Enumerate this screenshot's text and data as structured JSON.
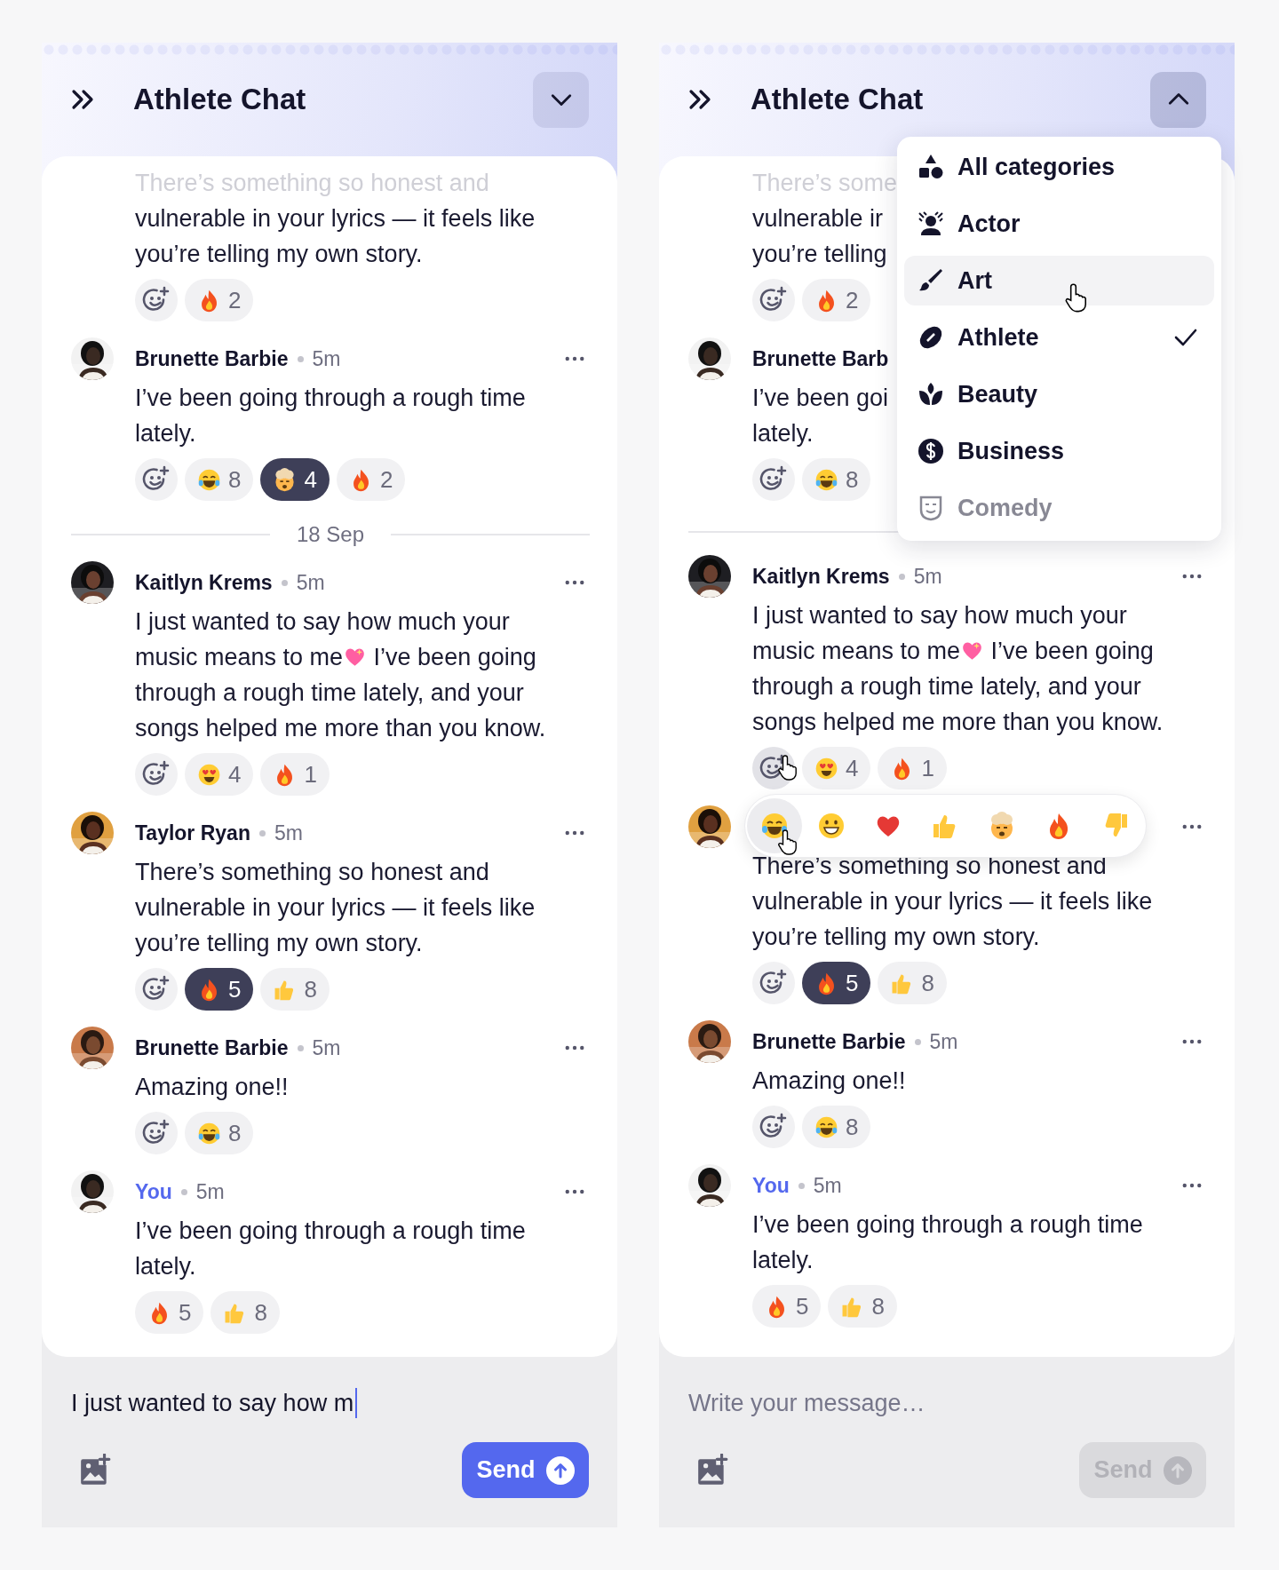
{
  "panels": [
    {
      "header": {
        "title": "Athlete Chat",
        "expanded": false
      },
      "messages": [
        {
          "kind": "message",
          "faded": true,
          "lines": [
            {
              "text": "There’s something so honest and"
            },
            {
              "text": "vulnerable in your lyrics — it feels like"
            },
            {
              "text": "you’re telling my own story."
            }
          ],
          "add_reaction": {
            "hovered": false
          },
          "reactions": [
            {
              "kind": "fire",
              "count": "2",
              "selected": false
            }
          ]
        },
        {
          "kind": "message",
          "avatar": {
            "kind": "picture"
          },
          "name": "Brunette Barbie",
          "time": "5m",
          "own": false,
          "lines": [
            {
              "text": "I’ve been going through a rough time"
            },
            {
              "text": "lately."
            }
          ],
          "add_reaction": {
            "hovered": false
          },
          "reactions": [
            {
              "kind": "laugh",
              "count": "8",
              "selected": false
            },
            {
              "kind": "exploding-head",
              "count": "4",
              "selected": true
            },
            {
              "kind": "fire",
              "count": "2",
              "selected": false
            }
          ]
        },
        {
          "kind": "separator",
          "label": "18 Sep"
        },
        {
          "kind": "message",
          "avatar": {
            "kind": "picture"
          },
          "name": "Kaitlyn Krems",
          "time": "5m",
          "own": false,
          "lines": [
            {
              "text": "I just wanted to say how much your"
            },
            {
              "text": "music means to me",
              "kind": "sparkling-heart",
              "after": "I’ve been going"
            },
            {
              "text": "through a rough time lately, and your"
            },
            {
              "text": "songs helped me more than you know."
            }
          ],
          "add_reaction": {
            "hovered": false
          },
          "reactions": [
            {
              "kind": "heart-eyes",
              "count": "4",
              "selected": false
            },
            {
              "kind": "fire",
              "count": "1",
              "selected": false
            }
          ]
        },
        {
          "kind": "message",
          "avatar": {
            "kind": "picture"
          },
          "name": "Taylor Ryan",
          "time": "5m",
          "own": false,
          "lines": [
            {
              "text": "There’s something so honest and"
            },
            {
              "text": "vulnerable in your lyrics — it feels like"
            },
            {
              "text": "you’re telling my own story."
            }
          ],
          "add_reaction": {
            "hovered": false
          },
          "reactions": [
            {
              "kind": "fire",
              "count": "5",
              "selected": true
            },
            {
              "kind": "thumbs-up",
              "count": "8",
              "selected": false
            }
          ]
        },
        {
          "kind": "message",
          "avatar": {
            "kind": "picture"
          },
          "name": "Brunette Barbie",
          "time": "5m",
          "own": false,
          "lines": [
            {
              "text": "Amazing one!!"
            }
          ],
          "add_reaction": {
            "hovered": false
          },
          "reactions": [
            {
              "kind": "laugh",
              "count": "8",
              "selected": false
            }
          ]
        },
        {
          "kind": "message",
          "avatar": {
            "kind": "picture"
          },
          "name": "You",
          "time": "5m",
          "own": true,
          "lines": [
            {
              "text": "I’ve been going through a rough time"
            },
            {
              "text": "lately."
            }
          ],
          "reactions": [
            {
              "kind": "fire",
              "count": "5",
              "selected": false
            },
            {
              "kind": "thumbs-up",
              "count": "8",
              "selected": false
            }
          ]
        }
      ],
      "composer": {
        "value": "I just wanted to say how m",
        "focused": true,
        "send": {
          "label": "Send",
          "disabled": false
        }
      }
    },
    {
      "header": {
        "title": "Athlete Chat",
        "expanded": true
      },
      "dropdown": {
        "items": [
          {
            "label": "All categories",
            "kind": "shapes",
            "hovered": false,
            "checked": false
          },
          {
            "label": "Actor",
            "kind": "actor",
            "hovered": false,
            "checked": false
          },
          {
            "label": "Art",
            "kind": "brush",
            "hovered": true,
            "checked": false
          },
          {
            "label": "Athlete",
            "kind": "football",
            "hovered": false,
            "checked": true
          },
          {
            "label": "Beauty",
            "kind": "lotus",
            "hovered": false,
            "checked": false
          },
          {
            "label": "Business",
            "kind": "dollar",
            "hovered": false,
            "checked": false
          },
          {
            "label": "Comedy",
            "kind": "mask",
            "hovered": false,
            "checked": false
          }
        ]
      },
      "messages": [
        {
          "kind": "message",
          "faded": true,
          "lines": [
            {
              "text": "There’s some"
            },
            {
              "text": "vulnerable ir"
            },
            {
              "text": "you’re telling"
            }
          ],
          "add_reaction": {
            "hovered": false
          },
          "reactions": [
            {
              "kind": "fire",
              "count": "2",
              "selected": false
            }
          ]
        },
        {
          "kind": "message",
          "avatar": {
            "kind": "picture"
          },
          "name": "Brunette Barb",
          "own": false,
          "lines": [
            {
              "text": "I’ve been goi"
            },
            {
              "text": "lately."
            }
          ],
          "add_reaction": {
            "hovered": false
          },
          "reactions": [
            {
              "kind": "laugh",
              "count": "8",
              "selected": false
            }
          ]
        },
        {
          "kind": "separator"
        },
        {
          "kind": "message",
          "avatar": {
            "kind": "picture"
          },
          "name": "Kaitlyn Krems",
          "time": "5m",
          "own": false,
          "lines": [
            {
              "text": "I just wanted to say how much your"
            },
            {
              "text": "music means to me",
              "kind": "sparkling-heart",
              "after": "I’ve been going"
            },
            {
              "text": "through a rough time lately, and your"
            },
            {
              "text": "songs helped me more than you know."
            }
          ],
          "add_reaction": {
            "hovered": true
          },
          "reactions": [
            {
              "kind": "heart-eyes",
              "count": "4",
              "selected": false
            },
            {
              "kind": "fire",
              "count": "1",
              "selected": false
            }
          ]
        },
        {
          "kind": "message",
          "avatar": {
            "kind": "picture"
          },
          "picker": {
            "emojis": [
              {
                "kind": "laugh",
                "hovered": true
              },
              {
                "kind": "grin",
                "hovered": false
              },
              {
                "kind": "heart",
                "hovered": false
              },
              {
                "kind": "thumbs-up",
                "hovered": false
              },
              {
                "kind": "exploding-head",
                "hovered": false
              },
              {
                "kind": "fire",
                "hovered": false
              },
              {
                "kind": "thumbs-down",
                "hovered": false
              }
            ]
          },
          "lines": [
            {
              "text": "There’s something so honest and"
            },
            {
              "text": "vulnerable in your lyrics — it feels like"
            },
            {
              "text": "you’re telling my own story."
            }
          ],
          "add_reaction": {
            "hovered": false
          },
          "reactions": [
            {
              "kind": "fire",
              "count": "5",
              "selected": true
            },
            {
              "kind": "thumbs-up",
              "count": "8",
              "selected": false
            }
          ]
        },
        {
          "kind": "message",
          "avatar": {
            "kind": "picture"
          },
          "name": "Brunette Barbie",
          "time": "5m",
          "own": false,
          "lines": [
            {
              "text": "Amazing one!!"
            }
          ],
          "add_reaction": {
            "hovered": false
          },
          "reactions": [
            {
              "kind": "laugh",
              "count": "8",
              "selected": false
            }
          ]
        },
        {
          "kind": "message",
          "avatar": {
            "kind": "picture"
          },
          "name": "You",
          "time": "5m",
          "own": true,
          "lines": [
            {
              "text": "I’ve been going through a rough time"
            },
            {
              "text": "lately."
            }
          ],
          "reactions": [
            {
              "kind": "fire",
              "count": "5",
              "selected": false
            },
            {
              "kind": "thumbs-up",
              "count": "8",
              "selected": false
            }
          ]
        }
      ],
      "composer": {
        "placeholder": "Write your message…",
        "focused": false,
        "send": {
          "label": "Send",
          "disabled": true
        }
      }
    }
  ]
}
